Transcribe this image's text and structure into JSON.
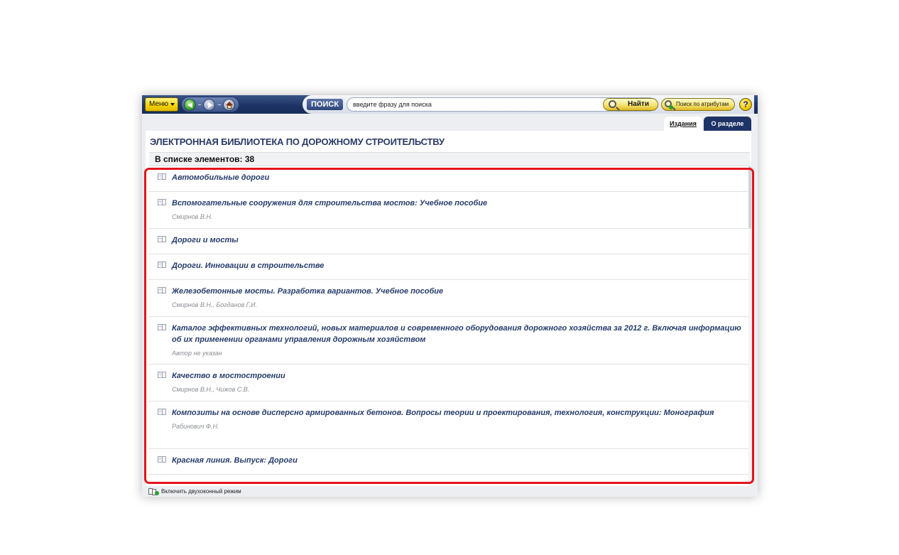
{
  "toolbar": {
    "menu_label": "Меню",
    "search_label": "ПОИСК",
    "search_value": "введите фразу для поиска",
    "find_label": "Найти",
    "attr_search_label": "Поиск по атрибутам",
    "help_label": "?"
  },
  "tabs": [
    {
      "label": "Издания",
      "active": true
    },
    {
      "label": "О разделе",
      "active": false
    }
  ],
  "library": {
    "title": "ЭЛЕКТРОННАЯ БИБЛИОТЕКА ПО ДОРОЖНОМУ СТРОИТЕЛЬСТВУ",
    "count_label": "В списке элементов: 38"
  },
  "items": [
    {
      "title": "Автомобильные дороги",
      "author": ""
    },
    {
      "title": "Вспомогательные сооружения для строительства мостов: Учебное пособие",
      "author": "Смирнов В.Н."
    },
    {
      "title": "Дороги и мосты",
      "author": ""
    },
    {
      "title": "Дороги. Инновации в строительстве",
      "author": ""
    },
    {
      "title": "Железобетонные мосты. Разработка вариантов. Учебное пособие",
      "author": "Смирнов В.Н., Богданов Г.И."
    },
    {
      "title": "Каталог эффективных технологий, новых материалов и современного оборудования дорожного хозяйства за 2012 г. Включая информацию об их применении органами управления дорожным хозяйством",
      "author": "Автор не указан"
    },
    {
      "title": "Качество в мостостроении",
      "author": "Смирнов В.Н., Чижов С.В."
    },
    {
      "title": "Композиты на основе дисперсно армированных бетонов. Вопросы теории и проектирования, технология, конструкции: Монография",
      "author": "Рабинович Ф.Н."
    },
    {
      "title": "Красная линия. Выпуск: Дороги",
      "author": ""
    }
  ],
  "status": {
    "dual_mode_label": "Включить двухоконный режим"
  },
  "colors": {
    "toolbar_navy": "#1e3466",
    "accent_yellow": "#f3e06a",
    "title_blue": "#263c6c",
    "highlight_red": "#e3141b"
  }
}
